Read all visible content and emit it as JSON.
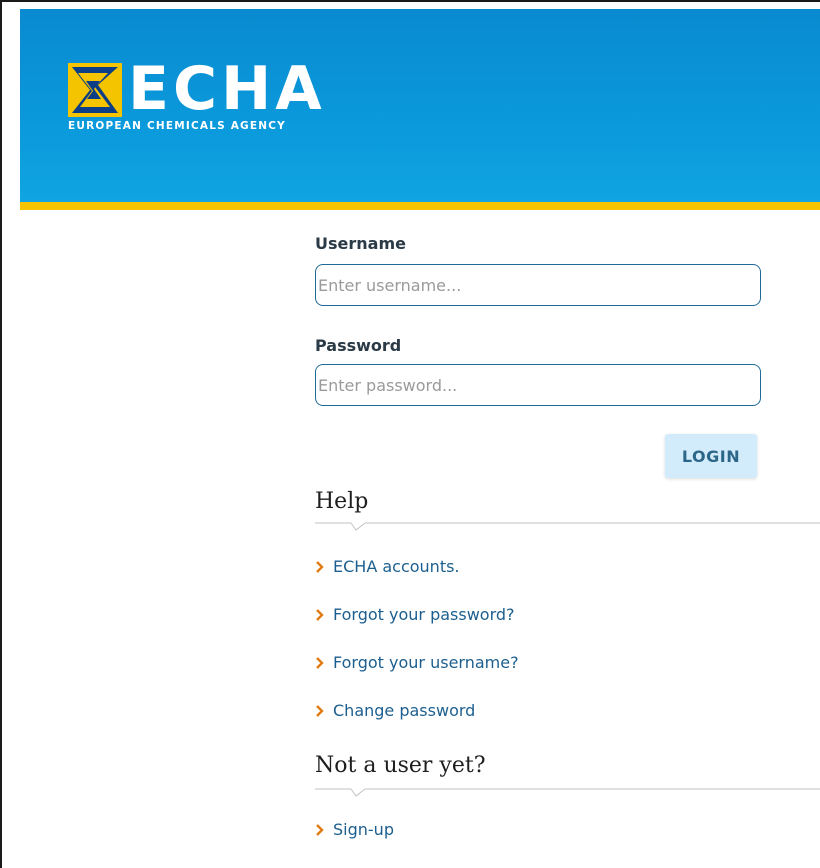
{
  "brand": {
    "name": "ECHA",
    "subtitle": "EUROPEAN CHEMICALS AGENCY",
    "logo_mark_icon": "echa-star-logo-icon",
    "colors": {
      "header_blue": "#0a98da",
      "stripe_yellow": "#f5c400",
      "link_blue": "#1c5f8f",
      "chevron_orange": "#e07b12"
    }
  },
  "login_form": {
    "username_label": "Username",
    "username_placeholder": "Enter username...",
    "username_value": "",
    "password_label": "Password",
    "password_placeholder": "Enter password...",
    "password_value": "",
    "login_button_label": "LOGIN"
  },
  "help": {
    "title": "Help",
    "links": [
      {
        "label": "ECHA accounts.",
        "icon": "chevron-right-icon"
      },
      {
        "label": "Forgot your password?",
        "icon": "chevron-right-icon"
      },
      {
        "label": "Forgot your username?",
        "icon": "chevron-right-icon"
      },
      {
        "label": "Change password",
        "icon": "chevron-right-icon"
      }
    ]
  },
  "signup": {
    "title": "Not a user yet?",
    "links": [
      {
        "label": "Sign-up",
        "icon": "chevron-right-icon"
      }
    ]
  }
}
